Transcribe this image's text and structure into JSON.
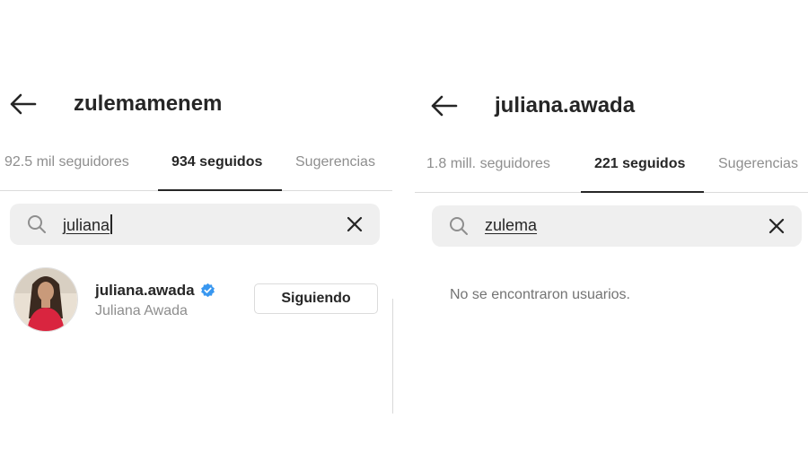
{
  "left": {
    "title": "zulemamenem",
    "tabs": [
      {
        "label": "92.5 mil seguidores"
      },
      {
        "label": "934 seguidos"
      },
      {
        "label": "Sugerencias"
      }
    ],
    "search": {
      "value": "juliana"
    },
    "result": {
      "username": "juliana.awada",
      "full_name": "Juliana Awada",
      "button_label": "Siguiendo",
      "verified": true
    }
  },
  "right": {
    "title": "juliana.awada",
    "tabs": [
      {
        "label": "1.8 mill. seguidores"
      },
      {
        "label": "221 seguidos"
      },
      {
        "label": "Sugerencias"
      }
    ],
    "search": {
      "value": "zulema"
    },
    "empty_message": "No se encontraron usuarios."
  },
  "colors": {
    "text_primary": "#262626",
    "text_secondary": "#8e8e8e",
    "search_bg": "#efefef",
    "verified_blue": "#3897f0"
  },
  "icons": [
    "arrow-left-icon",
    "search-icon",
    "close-icon",
    "verified-badge-icon"
  ]
}
